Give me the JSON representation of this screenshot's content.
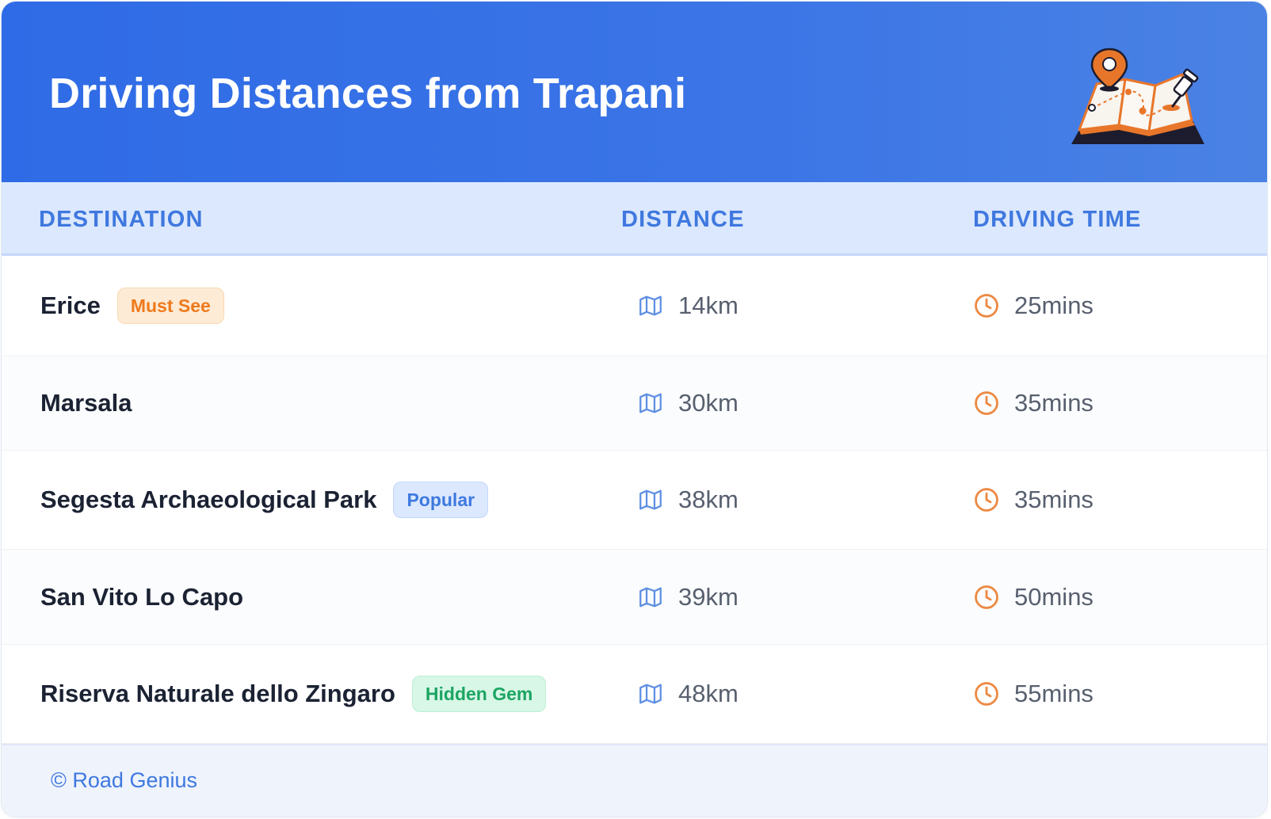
{
  "header": {
    "title": "Driving Distances from Trapani",
    "illustration_icon": "map-with-pins-icon"
  },
  "columns": {
    "destination": "DESTINATION",
    "distance": "DISTANCE",
    "driving_time": "DRIVING TIME"
  },
  "rows": [
    {
      "destination": "Erice",
      "badge": "Must See",
      "badge_color": "#ee7a1c",
      "distance": "14km",
      "time": "25mins"
    },
    {
      "destination": "Marsala",
      "badge": "",
      "badge_color": "",
      "distance": "30km",
      "time": "35mins"
    },
    {
      "destination": "Segesta Archaeological Park",
      "badge": "Popular",
      "badge_color": "#3d79df",
      "distance": "38km",
      "time": "35mins"
    },
    {
      "destination": "San Vito Lo Capo",
      "badge": "",
      "badge_color": "",
      "distance": "39km",
      "time": "50mins"
    },
    {
      "destination": "Riserva Naturale dello Zingaro",
      "badge": "Hidden Gem",
      "badge_color": "#1ca563",
      "distance": "48km",
      "time": "55mins"
    }
  ],
  "icons": {
    "distance": "map-icon",
    "time": "clock-icon"
  },
  "colors": {
    "header_bg": "#2f6be6",
    "accent_blue": "#3f78df",
    "accent_orange": "#ee7a1c"
  },
  "footer": {
    "text": "© Road Genius"
  }
}
